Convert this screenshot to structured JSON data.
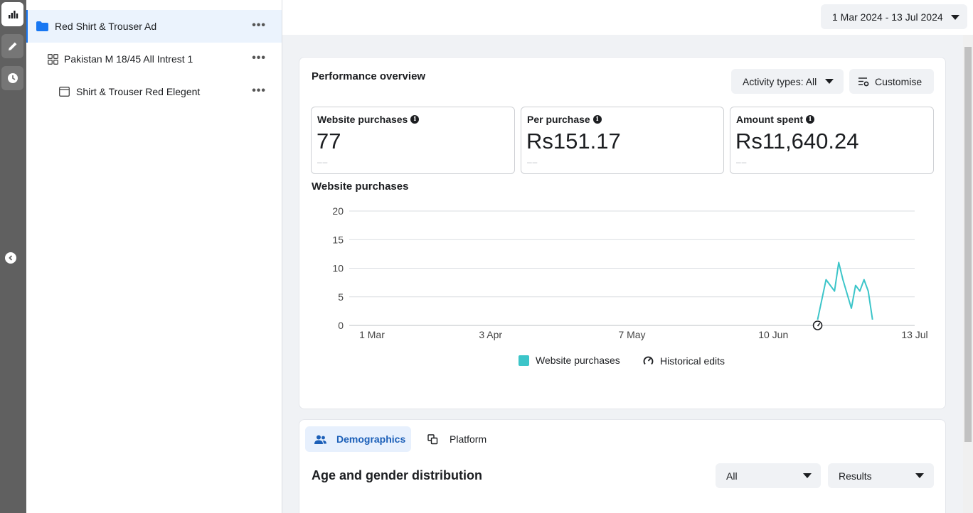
{
  "rail": {
    "items": [
      {
        "icon": "bar-chart-icon",
        "active": true
      },
      {
        "icon": "pencil-icon",
        "active": false
      },
      {
        "icon": "clock-icon",
        "active": false
      }
    ]
  },
  "tree": {
    "campaign": "Red Shirt & Trouser Ad",
    "adset": "Pakistan M 18/45 All Intrest 1",
    "ad": "Shirt & Trouser Red Elegent",
    "more_label": "•••"
  },
  "header": {
    "date_range": "1 Mar 2024 - 13 Jul 2024"
  },
  "overview": {
    "title": "Performance overview",
    "activity_label": "Activity types: All",
    "customise_label": "Customise",
    "metrics": [
      {
        "label": "Website purchases",
        "value": "77",
        "compare": "––"
      },
      {
        "label": "Per purchase",
        "value": "Rs151.17",
        "compare": "––"
      },
      {
        "label": "Amount spent",
        "value": "Rs11,640.24",
        "compare": "––"
      }
    ],
    "chart_title": "Website purchases",
    "legend": {
      "series_label": "Website purchases",
      "edits_label": "Historical edits"
    }
  },
  "chart_data": {
    "type": "line",
    "ylim": [
      0,
      20
    ],
    "yticks": [
      "0",
      "5",
      "10",
      "15",
      "20"
    ],
    "xticks": [
      "1 Mar",
      "3 Apr",
      "7 May",
      "10 Jun",
      "13 Jul"
    ],
    "x_range_days": [
      0,
      134
    ],
    "series": [
      {
        "name": "Website purchases",
        "color": "#3cc5c9",
        "points": [
          [
            111,
            1
          ],
          [
            113,
            8
          ],
          [
            115,
            6
          ],
          [
            116,
            11
          ],
          [
            117,
            8
          ],
          [
            119,
            3
          ],
          [
            120,
            7
          ],
          [
            121,
            6
          ],
          [
            122,
            8
          ],
          [
            123,
            6
          ],
          [
            124,
            1
          ]
        ]
      }
    ],
    "historical_edit_days": [
      111
    ]
  },
  "breakdown": {
    "tabs": [
      {
        "label": "Demographics",
        "icon": "people-icon",
        "active": true
      },
      {
        "label": "Platform",
        "icon": "platform-icon",
        "active": false
      }
    ],
    "section_title": "Age and gender distribution",
    "filter_all": "All",
    "filter_metric": "Results"
  },
  "colors": {
    "accent": "#1877f2",
    "series": "#3cc5c9"
  }
}
